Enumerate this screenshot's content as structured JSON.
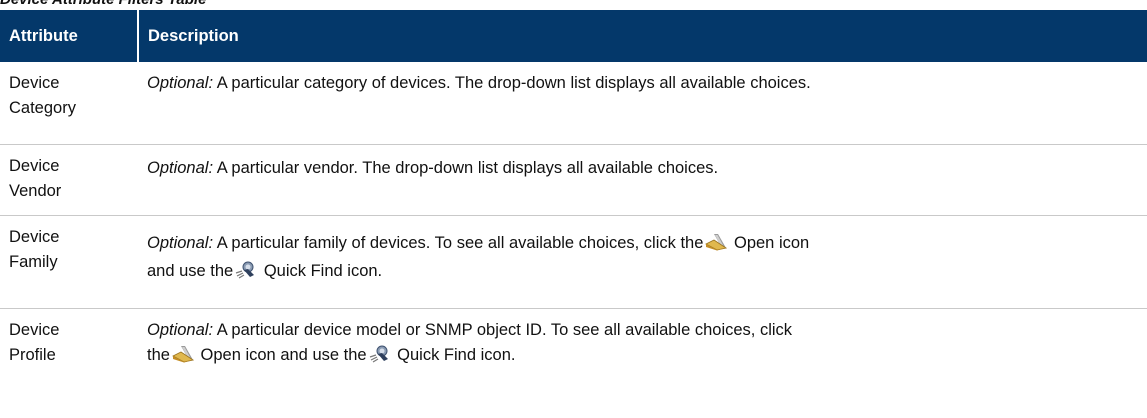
{
  "caption": "Device Attribute Filters Table",
  "table": {
    "headers": [
      "Attribute",
      "Description"
    ],
    "rows": [
      {
        "attribute_line1": "Device",
        "attribute_line2": "Category",
        "optional_label": "Optional:",
        "text": " A particular category of devices. The drop-down list displays all available choices."
      },
      {
        "attribute_line1": "Device",
        "attribute_line2": "Vendor",
        "optional_label": "Optional:",
        "text": " A particular vendor. The drop-down list displays all available choices."
      },
      {
        "attribute_line1": "Device",
        "attribute_line2": "Family",
        "optional_label": "Optional:",
        "text_before_open": " A particular family of devices. To see all available choices, click the",
        "open_icon_label": " Open icon",
        "text_mid": " and use the",
        "quickfind_icon_label": " Quick Find icon",
        "text_end": "."
      },
      {
        "attribute_line1": "Device",
        "attribute_line2": "Profile",
        "optional_label": "Optional:",
        "text_line1": " A particular device model or SNMP object ID. To see all available choices, click",
        "text_before_open": "the",
        "open_icon_label": " Open icon",
        "text_mid": " and use the",
        "quickfind_icon_label": " Quick Find icon",
        "text_end": "."
      }
    ]
  },
  "icons": {
    "open_icon": "open-icon",
    "quick_find_icon": "quick-find-icon"
  },
  "colors": {
    "header_bg": "#04386a",
    "header_text": "#ffffff",
    "row_divider": "#c9c9c9"
  }
}
